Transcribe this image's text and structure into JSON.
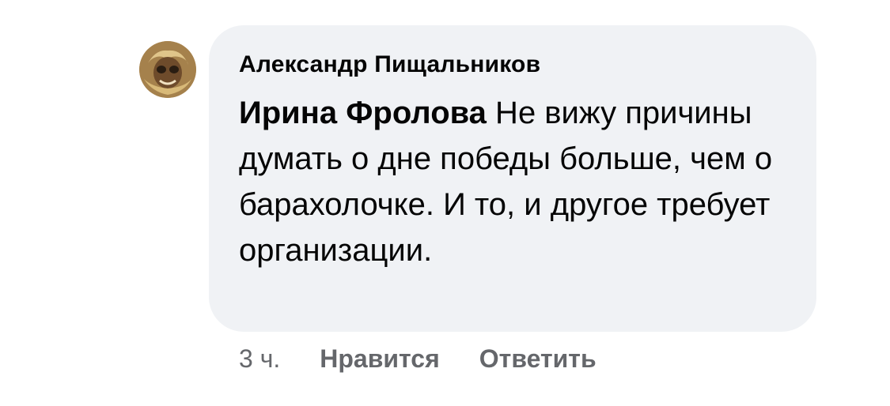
{
  "comment": {
    "author": "Александр Пищальников",
    "mention": "Ирина Фролова",
    "text": " Не вижу причины думать о дне победы больше, чем о барахолочке. И то, и другое требует организации.",
    "avatar_icon": "user-avatar"
  },
  "actions": {
    "time": "3 ч.",
    "like_label": "Нравится",
    "reply_label": "Ответить"
  },
  "colors": {
    "bubble_bg": "#f0f2f5",
    "text": "#050505",
    "secondary": "#65676b"
  }
}
